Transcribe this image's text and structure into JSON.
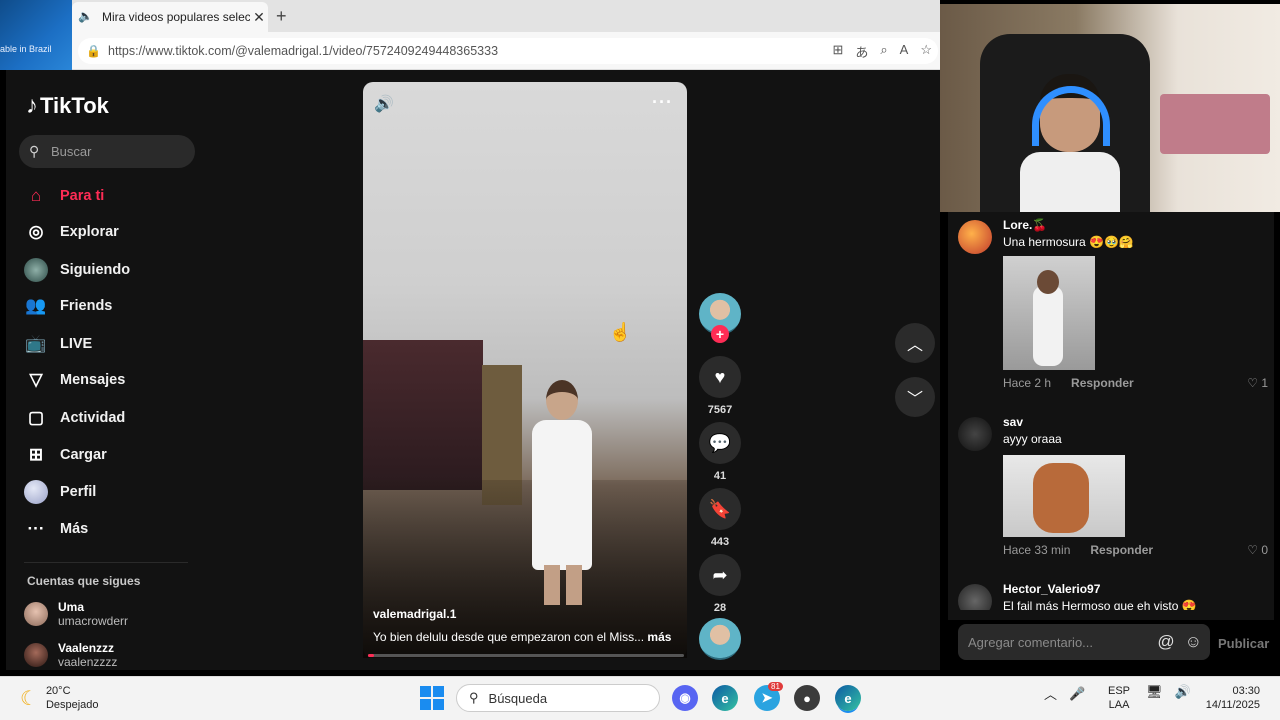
{
  "browser": {
    "side_thumb_text": "able in Brazil",
    "tab_title": "Mira videos populares selecc",
    "new_tab": "+",
    "url": "https://www.tiktok.com/@valemadrigal.1/video/7572409249448365333"
  },
  "tiktok": {
    "logo": "TikTok",
    "search_placeholder": "Buscar",
    "nav": [
      {
        "label": "Para ti",
        "icon": "home-icon"
      },
      {
        "label": "Explorar",
        "icon": "compass-icon"
      },
      {
        "label": "Siguiendo",
        "icon": "following-avatar"
      },
      {
        "label": "Friends",
        "icon": "friends-icon"
      },
      {
        "label": "LIVE",
        "icon": "live-icon"
      },
      {
        "label": "Mensajes",
        "icon": "messages-icon"
      },
      {
        "label": "Actividad",
        "icon": "activity-icon"
      },
      {
        "label": "Cargar",
        "icon": "upload-icon"
      },
      {
        "label": "Perfil",
        "icon": "profile-avatar"
      },
      {
        "label": "Más",
        "icon": "more-icon"
      }
    ],
    "following_header": "Cuentas que sigues",
    "following": [
      {
        "name": "Uma",
        "user": "umacrowderr"
      },
      {
        "name": "Vaalenzzz",
        "user": "vaalenzzzz"
      }
    ],
    "video": {
      "username": "valemadrigal.1",
      "description": "Yo bien delulu desde que empezaron con el Miss...",
      "more": "más",
      "progress": 0.02
    },
    "actions": {
      "likes": "7567",
      "comments": "41",
      "saves": "443",
      "shares": "28"
    },
    "comments": [
      {
        "name": "Lore.🍒",
        "text": "Una hermosura 😍🥹🤗",
        "time": "Hace 2 h",
        "reply": "Responder",
        "likes": "1"
      },
      {
        "name": "sav",
        "text": "ayyy oraaa",
        "time": "Hace 33 min",
        "reply": "Responder",
        "likes": "0"
      },
      {
        "name": "Hector_Valerio97",
        "text": "El fail más Hermoso que eh visto 😍",
        "time": "",
        "reply": "",
        "likes": ""
      }
    ],
    "comment_placeholder": "Agregar comentario...",
    "publish": "Publicar"
  },
  "taskbar": {
    "temp": "20°C",
    "weather": "Despejado",
    "search": "Búsqueda",
    "lang1": "ESP",
    "lang2": "LAA",
    "time": "03:30",
    "date": "14/11/2025",
    "telegram_badge": "81"
  },
  "colors": {
    "accent": "#fe2c55",
    "windows_blue": "#1a8cf0"
  }
}
